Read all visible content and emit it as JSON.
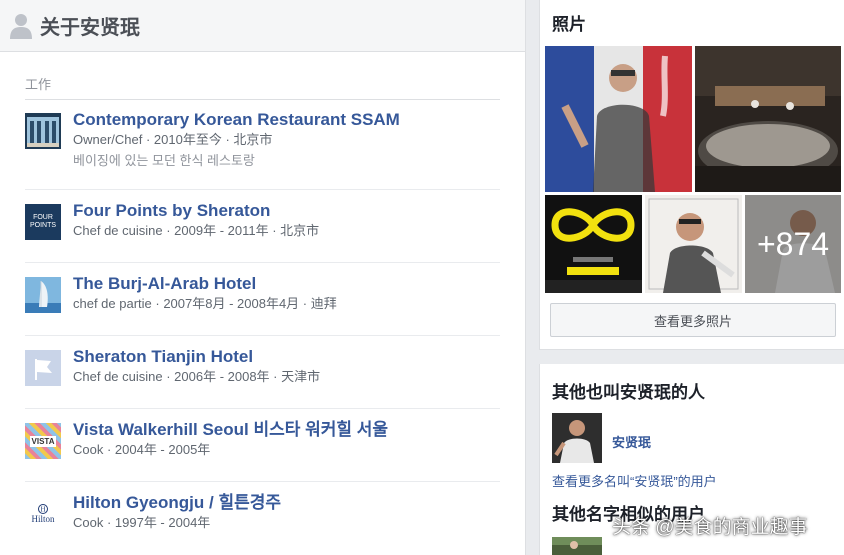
{
  "header": {
    "title": "关于安贤珉"
  },
  "work": {
    "section_label": "工作",
    "jobs": [
      {
        "name": "Contemporary Korean Restaurant SSAM",
        "meta": "Owner/Chef · 2010年至今 · 北京市",
        "desc": "베이징에 있는 모던 한식 레스토랑"
      },
      {
        "name": "Four Points by Sheraton",
        "meta": "Chef de cuisine · 2009年 - 2011年 · 北京市",
        "logo_text": "FOUR POINTS"
      },
      {
        "name": "The Burj-Al-Arab Hotel",
        "meta": "chef de partie · 2007年8月 - 2008年4月 · 迪拜"
      },
      {
        "name": "Sheraton Tianjin Hotel",
        "meta": "Chef de cuisine · 2006年 - 2008年 · 天津市"
      },
      {
        "name": "Vista Walkerhill Seoul 비스타 워커힐 서울",
        "meta": "Cook · 2004年 - 2005年",
        "logo_text": "VISTA"
      },
      {
        "name": "Hilton Gyeongju / 힐튼경주",
        "meta": "Cook · 1997年 - 2004年",
        "logo_text": "Hilton"
      }
    ]
  },
  "photos": {
    "title": "照片",
    "more_count": "+874",
    "more_button": "查看更多照片"
  },
  "people": {
    "title": "其他也叫安贤珉的人",
    "person_name": "安贤珉",
    "see_more": "查看更多名叫“安贤珉”的用户",
    "similar_title": "其他名字相似的用户"
  },
  "watermark": "头条 @美食的商业趣事",
  "colors": {
    "link": "#365899",
    "panel_bg": "#e9ebee",
    "header_bg": "#f5f6f7"
  }
}
